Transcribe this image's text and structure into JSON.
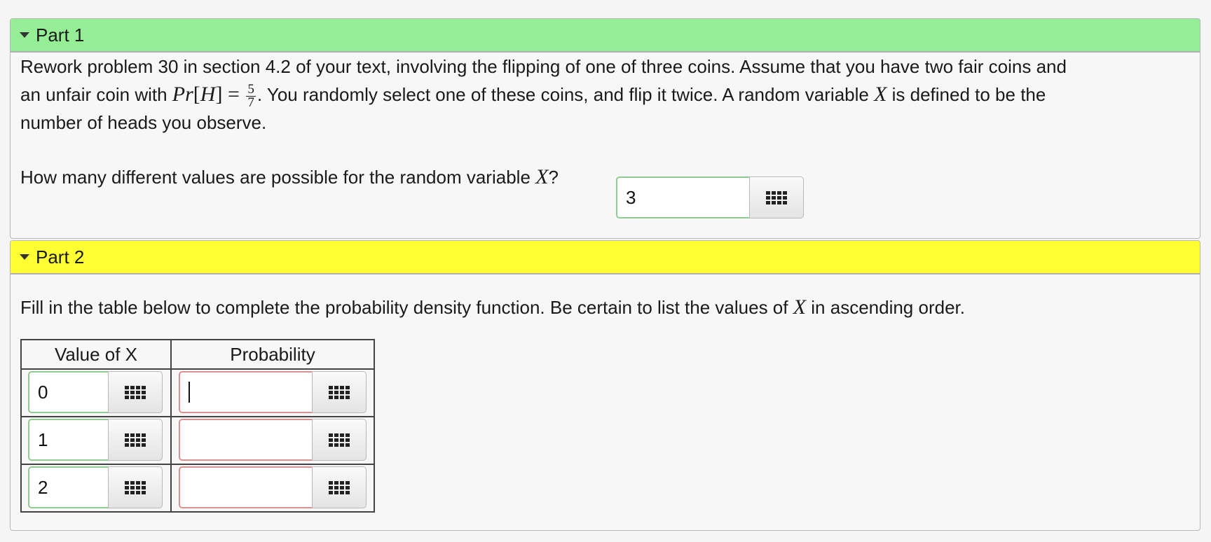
{
  "part1": {
    "title": "Part 1",
    "text_line1": "Rework problem 30 in section 4.2 of your text, involving the flipping of one of three coins. Assume that you have two fair coins and",
    "text_line2_a": "an unfair coin with ",
    "math_pr": "Pr",
    "math_H": "H",
    "math_frac_num": "5",
    "math_frac_den": "7",
    "text_line2_b": ". You randomly select one of these coins, and flip it twice. A random variable ",
    "math_X": "X",
    "text_line2_c": " is defined to be the",
    "text_line3": "number of heads you observe.",
    "question": "How many different values are possible for the random variable ",
    "question_var": "X",
    "question_end": "?",
    "answer_value": "3"
  },
  "part2": {
    "title": "Part 2",
    "instruction_a": "Fill in the table below to complete the probability density function. Be certain to list the values of ",
    "instruction_var": "X",
    "instruction_b": " in ascending order.",
    "table": {
      "headers": [
        "Value of X",
        "Probability"
      ],
      "rows": [
        {
          "value": "0",
          "probability": ""
        },
        {
          "value": "1",
          "probability": ""
        },
        {
          "value": "2",
          "probability": ""
        }
      ]
    }
  },
  "icons": {
    "toggle": "caret-down-icon",
    "keypad": "keypad-icon"
  },
  "colors": {
    "part1_header": "#95ee95",
    "part2_header": "#ffff33",
    "correct_border": "#8fcc8f",
    "incorrect_border": "#dd9090"
  }
}
